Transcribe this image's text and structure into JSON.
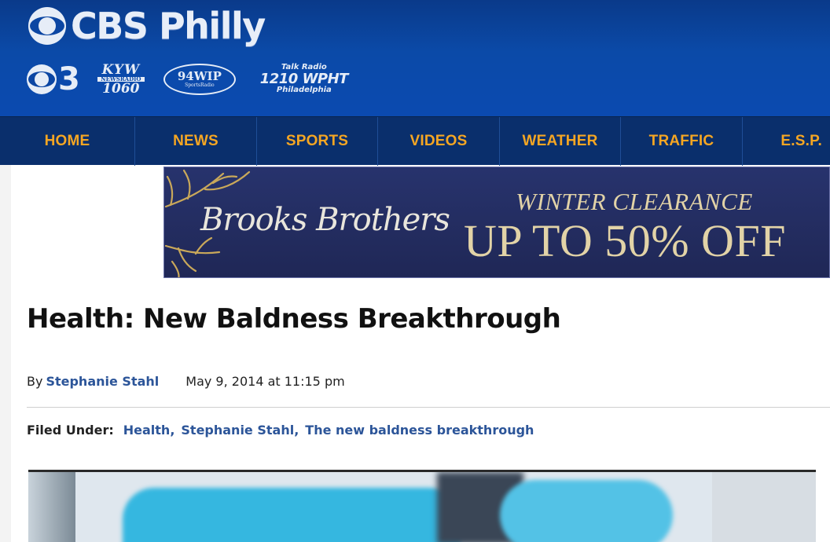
{
  "header": {
    "brand": "CBS Philly",
    "stations": {
      "cbs3": "3",
      "kyw_top": "KYW",
      "kyw_mid": "NEWSRADIO",
      "kyw_bottom": "1060",
      "wip": "94WIP",
      "wip_sub": "SportsRadio",
      "wpht_top": "Talk Radio",
      "wpht_main": "1210 WPHT",
      "wpht_city": "Philadelphia"
    }
  },
  "nav": {
    "items": [
      {
        "label": "HOME"
      },
      {
        "label": "NEWS"
      },
      {
        "label": "SPORTS"
      },
      {
        "label": "VIDEOS"
      },
      {
        "label": "WEATHER"
      },
      {
        "label": "TRAFFIC"
      },
      {
        "label": "E.S.P."
      }
    ]
  },
  "ad": {
    "brand": "Brooks Brothers",
    "headline": "WINTER CLEARANCE",
    "offer": "UP TO 50% OFF"
  },
  "article": {
    "title": "Health: New Baldness Breakthrough",
    "by_label": "By",
    "author": "Stephanie Stahl",
    "date": "May 9, 2014 at 11:15 pm",
    "filed_label": "Filed Under:",
    "tags": [
      "Health",
      "Stephanie Stahl",
      "The new baldness breakthrough"
    ],
    "tag_separator": ","
  },
  "colors": {
    "header_blue": "#0b4aa8",
    "nav_blue": "#0a2f6c",
    "nav_text": "#f5a623",
    "link_blue": "#2c5599",
    "ad_navy": "#232c5f",
    "ad_gold": "#e2d3a7"
  }
}
